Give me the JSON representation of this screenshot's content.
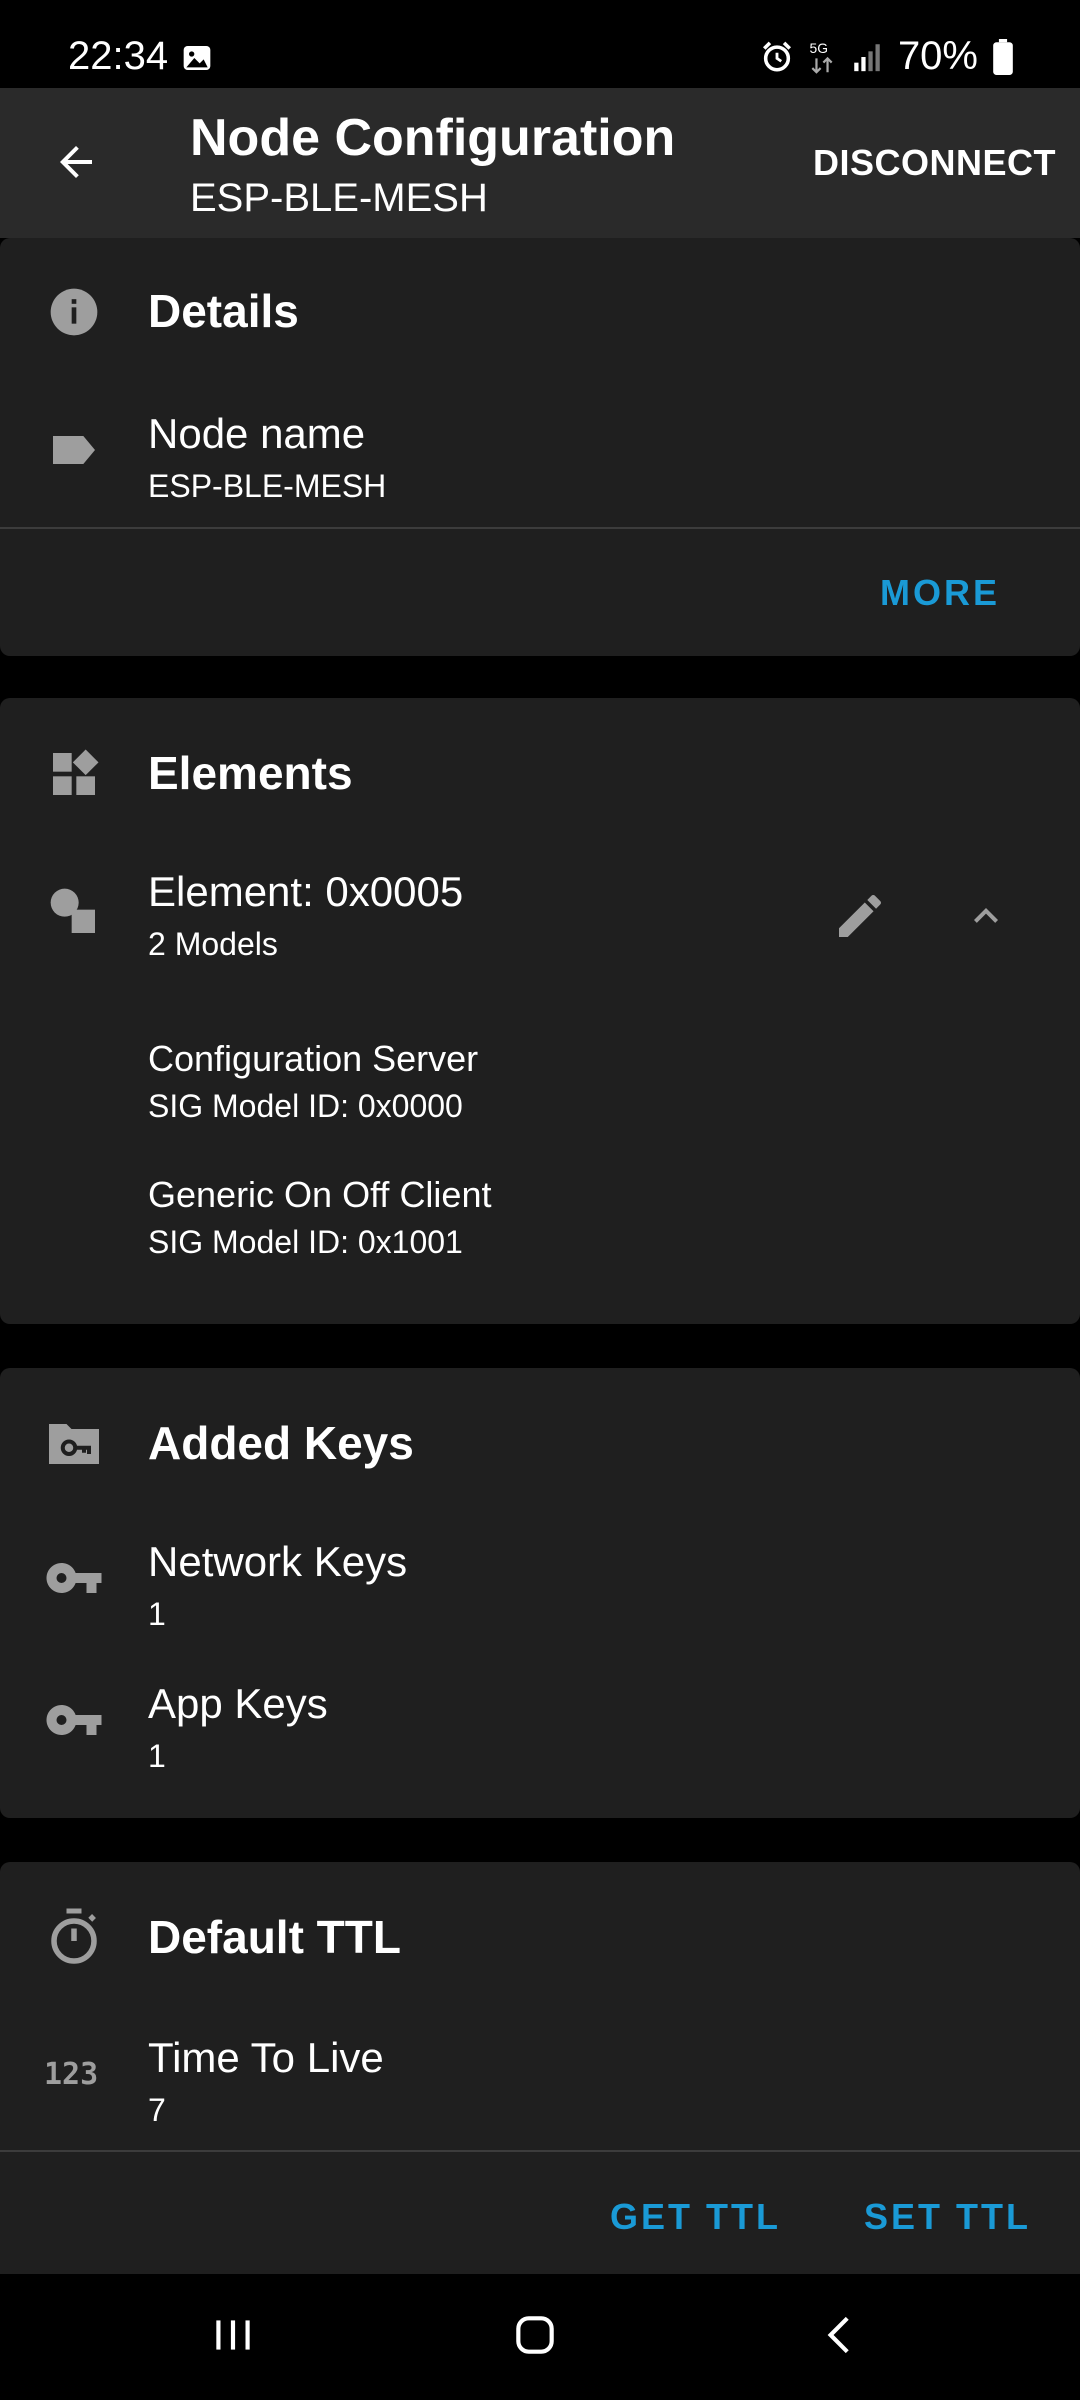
{
  "status_bar": {
    "time": "22:34",
    "battery": "70%",
    "network": "5G",
    "icons": [
      "gallery-icon",
      "alarm-icon",
      "5g-icon",
      "signal-icon",
      "battery-icon"
    ]
  },
  "app_bar": {
    "title": "Node Configuration",
    "subtitle": "ESP-BLE-MESH",
    "action": "DISCONNECT"
  },
  "details": {
    "title": "Details",
    "node_name_label": "Node name",
    "node_name_value": "ESP-BLE-MESH",
    "more": "MORE"
  },
  "elements": {
    "title": "Elements",
    "element_title": "Element: 0x0005",
    "element_sub": "2 Models",
    "models": [
      {
        "name": "Configuration Server",
        "id": "SIG Model ID: 0x0000"
      },
      {
        "name": "Generic On Off Client",
        "id": "SIG Model ID: 0x1001"
      }
    ]
  },
  "keys": {
    "title": "Added Keys",
    "network_label": "Network Keys",
    "network_value": "1",
    "app_label": "App Keys",
    "app_value": "1"
  },
  "ttl": {
    "title": "Default TTL",
    "label": "Time To Live",
    "value": "7",
    "get": "GET TTL",
    "set": "SET TTL"
  },
  "colors": {
    "accent": "#1a9ad6",
    "card": "#1f1f1f",
    "appbar": "#2a2a2a",
    "icon": "#9e9e9e"
  }
}
